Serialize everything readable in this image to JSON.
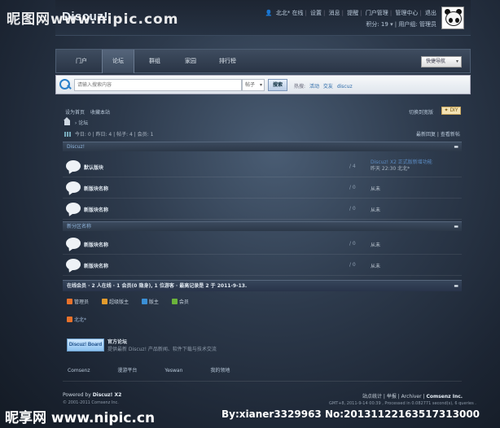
{
  "header": {
    "logo": "Discuz!",
    "user_links": [
      "北北*",
      "在线",
      "设置",
      "消息",
      "提醒",
      "门户管理",
      "管理中心",
      "退出"
    ],
    "credits": "积分: 19",
    "usergroup": "用户组: 管理员"
  },
  "nav": {
    "tabs": [
      "门户",
      "论坛",
      "群组",
      "家园",
      "排行榜"
    ],
    "active_tab": "论坛",
    "quick_nav": "快捷导航"
  },
  "search": {
    "placeholder": "请输入搜索内容",
    "type": "帖子",
    "button": "搜索",
    "hot_label": "热搜:",
    "hot_words": [
      "活动",
      "交友",
      "discuz"
    ]
  },
  "toolbar": {
    "left_links": [
      "设为首页",
      "收藏本站"
    ],
    "switch_style": "切换到宽版",
    "diy": "DIY"
  },
  "breadcrumb": {
    "current": "论坛"
  },
  "stats": {
    "text": "今日: 0 | 昨日: 4 | 帖子: 4 | 会员: 1",
    "right_links": [
      "最新回复",
      "查看新帖"
    ]
  },
  "categories": [
    {
      "name": "Discuz!",
      "forums": [
        {
          "name": "默认版块",
          "count": "/ 4",
          "last_title": "Discuz! X2 正式版新增功能",
          "last_time": "昨天 22:30 北北*"
        },
        {
          "name": "新版块名称",
          "count": "/ 0",
          "last": "从未"
        },
        {
          "name": "新版块名称",
          "count": "/ 0",
          "last": "从未"
        }
      ]
    },
    {
      "name": "新分区名称",
      "forums": [
        {
          "name": "新版块名称",
          "count": "/ 0",
          "last": "从未"
        },
        {
          "name": "新版块名称",
          "count": "/ 0",
          "last": "从未"
        }
      ]
    }
  ],
  "online": {
    "title": "在线会员 · 2 人在线 · 1 会员(0 隐身), 1 位游客 · 最高记录是 2 于 2011-9-13.",
    "legend": [
      {
        "label": "管理员",
        "color": "#e8722b"
      },
      {
        "label": "超级版主",
        "color": "#e39b2d"
      },
      {
        "label": "版主",
        "color": "#3a8fd6"
      },
      {
        "label": "会员",
        "color": "#6bb33b"
      }
    ],
    "user": "北北*"
  },
  "friend_link": {
    "logo_text": "Discuz! Board",
    "title": "官方论坛",
    "desc": "提供最新 Discuz! 产品新闻、软件下载与技术交流"
  },
  "footer": {
    "links": [
      "Comsenz",
      "漫游平台",
      "Yeswan",
      "我的领地"
    ],
    "powered_prefix": "Powered by",
    "powered_name": "Discuz! X2",
    "copyright": "© 2001-2011 Comsenz Inc.",
    "right_links": "站点统计 | 举报 | Archiver |",
    "company": "Comsenz Inc.",
    "gmt": "GMT+8, 2011-9-14 00:39 , Processed in 0.082771 second(s), 6 queries ."
  },
  "watermarks": {
    "top": "昵图网www.nipic.com",
    "bottom_left": "昵享网 www.nipic.cn",
    "bottom_right": "By:xianer3329963 No:20131122163517313000"
  }
}
